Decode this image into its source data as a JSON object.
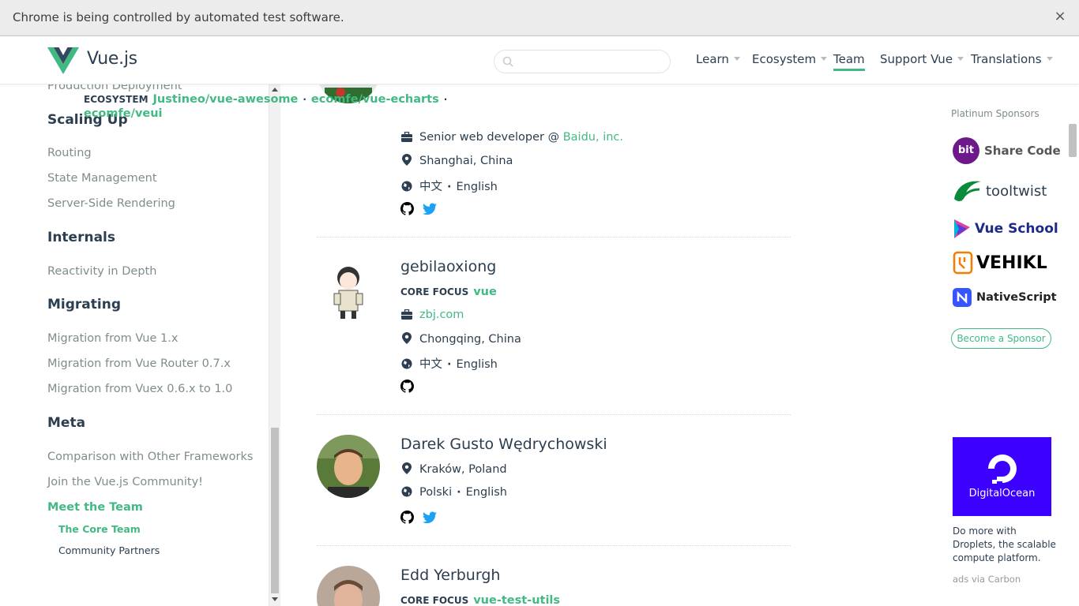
{
  "infobar": {
    "text": "Chrome is being controlled by automated test software.",
    "close": "×"
  },
  "header": {
    "logo_text": "Vue.js",
    "search_placeholder": "",
    "nav": [
      {
        "label": "Learn",
        "dropdown": true
      },
      {
        "label": "Ecosystem",
        "dropdown": true
      },
      {
        "label": "Team",
        "dropdown": false,
        "active": true
      },
      {
        "label": "Support Vue",
        "dropdown": true
      },
      {
        "label": "Translations",
        "dropdown": true
      }
    ]
  },
  "sidebar": {
    "partial_top": "Production Deployment",
    "scaling_up": {
      "heading": "Scaling Up",
      "items": [
        "Routing",
        "State Management",
        "Server-Side Rendering"
      ]
    },
    "internals": {
      "heading": "Internals",
      "items": [
        "Reactivity in Depth"
      ]
    },
    "migrating": {
      "heading": "Migrating",
      "items": [
        "Migration from Vue 1.x",
        "Migration from Vue Router 0.7.x",
        "Migration from Vuex 0.6.x to 1.0"
      ]
    },
    "meta": {
      "heading": "Meta",
      "items": [
        "Comparison with Other Frameworks",
        "Join the Vue.js Community!",
        "Meet the Team"
      ],
      "sub": [
        "The Core Team",
        "Community Partners"
      ]
    }
  },
  "members": [
    {
      "ecosystem_label": "ECOSYSTEM",
      "projects": [
        "Justineo/vue-awesome",
        "ecomfe/vue-echarts",
        "ecomfe/veui"
      ],
      "work_title": "Senior web developer @",
      "work_company": "Baidu, inc.",
      "location": "Shanghai, China",
      "languages": [
        "中文",
        "English"
      ]
    },
    {
      "name": "gebilaoxiong",
      "focus_label": "CORE FOCUS",
      "projects": [
        "vue"
      ],
      "work_company": "zbj.com",
      "location": "Chongqing, China",
      "languages": [
        "中文",
        "English"
      ]
    },
    {
      "name": "Darek Gusto Wędrychowski",
      "location": "Kraków, Poland",
      "languages": [
        "Polski",
        "English"
      ]
    },
    {
      "name": "Edd Yerburgh",
      "focus_label": "CORE FOCUS",
      "projects": [
        "vue-test-utils"
      ]
    }
  ],
  "sponsors": {
    "title": "Platinum Sponsors",
    "list": [
      "Share Code",
      "tooltwist",
      "Vue School",
      "VEHIKL",
      "NativeScript"
    ],
    "bit_badge": "bit",
    "become": "Become a Sponsor"
  },
  "ad": {
    "brand": "DigitalOcean",
    "description": "Do more with Droplets, the scalable compute platform.",
    "via": "ads via Carbon"
  },
  "colors": {
    "accent": "#42b983",
    "text": "#2c3e50",
    "muted": "#7f8c8d",
    "twitter": "#1da1f2",
    "digitalocean": "#3b00ff"
  }
}
